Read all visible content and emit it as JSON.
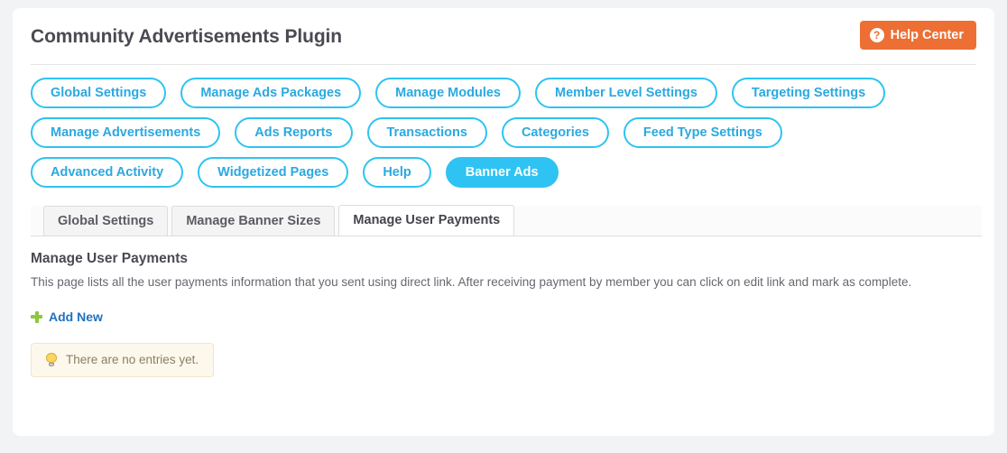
{
  "header": {
    "title": "Community Advertisements Plugin",
    "help_button": {
      "label": "Help Center",
      "icon": "question-circle-icon",
      "color": "#ed6f33"
    }
  },
  "pill_nav": {
    "accent_color": "#2ec3f2",
    "items": [
      {
        "label": "Global Settings",
        "active": false
      },
      {
        "label": "Manage Ads Packages",
        "active": false
      },
      {
        "label": "Manage Modules",
        "active": false
      },
      {
        "label": "Member Level Settings",
        "active": false
      },
      {
        "label": "Targeting Settings",
        "active": false
      },
      {
        "label": "Manage Advertisements",
        "active": false
      },
      {
        "label": "Ads Reports",
        "active": false
      },
      {
        "label": "Transactions",
        "active": false
      },
      {
        "label": "Categories",
        "active": false
      },
      {
        "label": "Feed Type Settings",
        "active": false
      },
      {
        "label": "Advanced Activity",
        "active": false
      },
      {
        "label": "Widgetized Pages",
        "active": false
      },
      {
        "label": "Help",
        "active": false
      },
      {
        "label": "Banner Ads",
        "active": true
      }
    ]
  },
  "tabs": [
    {
      "label": "Global Settings",
      "active": false
    },
    {
      "label": "Manage Banner Sizes",
      "active": false
    },
    {
      "label": "Manage User Payments",
      "active": true
    }
  ],
  "content": {
    "section_title": "Manage User Payments",
    "description": "This page lists all the user payments information that you sent using direct link. After receiving payment by member you can click on edit link and mark as complete.",
    "add_new_label": "Add New",
    "add_new_icon": "plus-icon",
    "notice": {
      "icon": "lightbulb-icon",
      "text": "There are no entries yet.",
      "background": "#fdf8ec"
    }
  }
}
